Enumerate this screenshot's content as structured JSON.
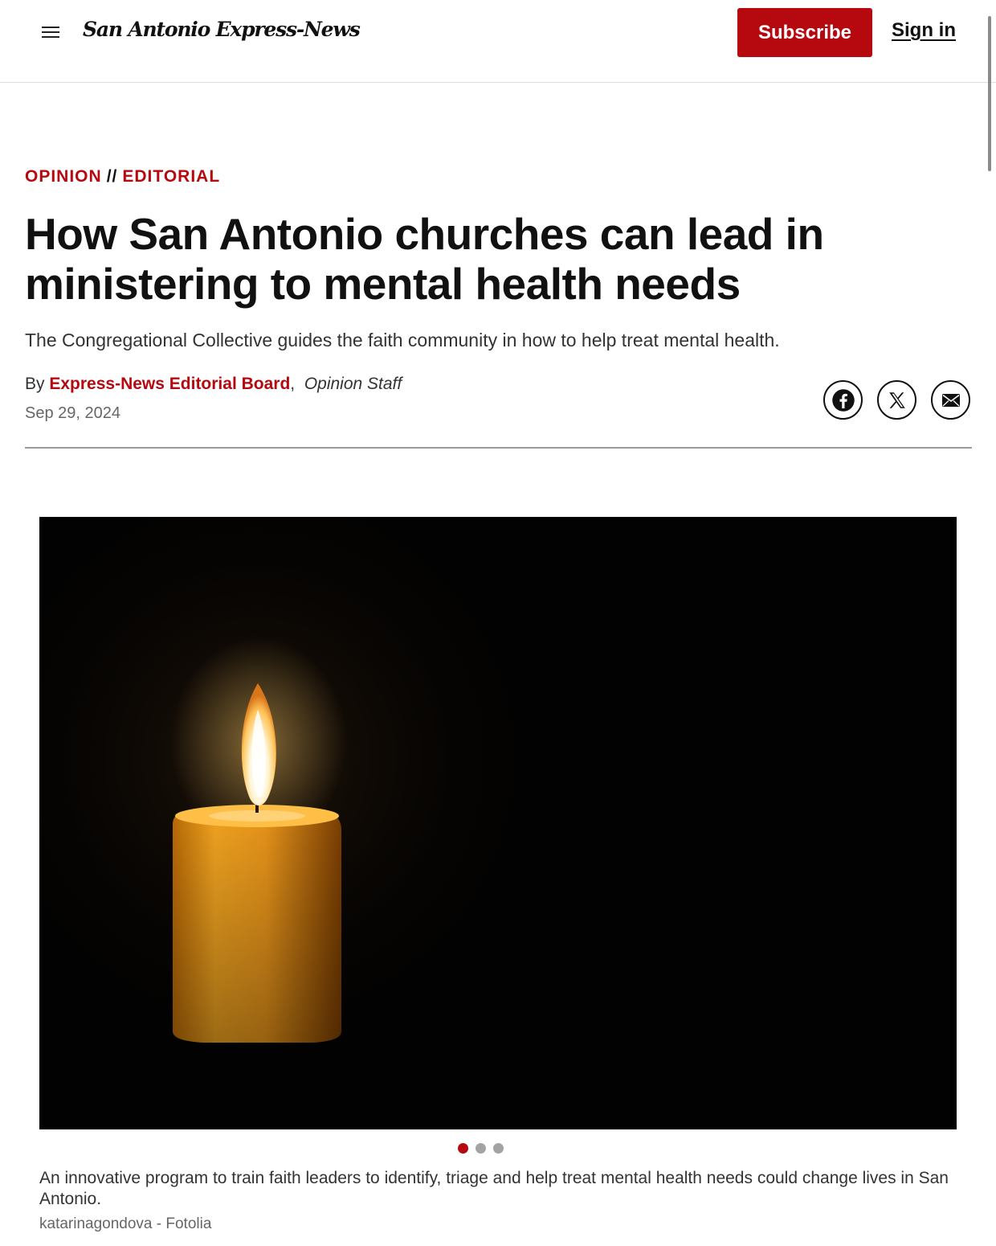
{
  "header": {
    "logo_text": "San Antonio Express-News",
    "subscribe_label": "Subscribe",
    "signin_label": "Sign in"
  },
  "article": {
    "section": "OPINION",
    "separator": "//",
    "subsection": "EDITORIAL",
    "headline": "How San Antonio churches can lead in ministering to mental health needs",
    "dek": "The Congregational Collective guides the faith community in how to help treat mental health.",
    "byline_prefix": "By",
    "author": "Express-News Editorial Board",
    "author_role": "Opinion Staff",
    "date": "Sep 29, 2024"
  },
  "share": {
    "icons": [
      "facebook-icon",
      "x-icon",
      "email-icon"
    ]
  },
  "media": {
    "image_subject": "lit candle in darkness",
    "slide_count": 3,
    "active_slide": 1,
    "caption": "An innovative program to train faith leaders to identify, triage and help treat mental health needs could change lives in San Antonio.",
    "credit": "katarinagondova - Fotolia"
  },
  "colors": {
    "brand_red": "#b5090f",
    "text": "#111111",
    "muted": "#666666"
  }
}
